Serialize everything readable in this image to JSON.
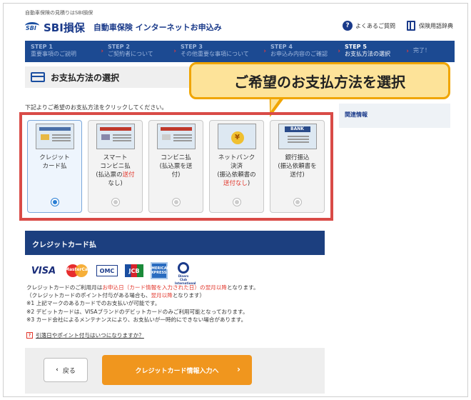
{
  "header": {
    "top_note": "自動車保険の見積りはSBI損保",
    "logo_mark": "SBI",
    "brand": "SBI損保",
    "subtitle": "自動車保険 インターネットお申込み",
    "faq_link": "よくあるご質問",
    "glossary_link": "保険用語辞典"
  },
  "steps": [
    {
      "num": "STEP 1",
      "label": "重要事項のご説明"
    },
    {
      "num": "STEP 2",
      "label": "ご契約者について"
    },
    {
      "num": "STEP 3",
      "label": "その他重要な事項について"
    },
    {
      "num": "STEP 4",
      "label": "お申込み内容のご確認"
    },
    {
      "num": "STEP 5",
      "label": "お支払方法の選択"
    },
    {
      "num": "",
      "label": "完了！"
    }
  ],
  "page_title": "お支払方法の選択",
  "callout": "ご希望のお支払方法を選択",
  "instruction": "下記よりご希望のお支払方法をクリックしてください。",
  "sidebar": {
    "related": "関連情報"
  },
  "methods": [
    {
      "line1": "クレジット",
      "line2": "カード払"
    },
    {
      "line1": "スマート",
      "line2": "コンビニ払",
      "line3": "(払込票の",
      "red": "送付",
      "line4": "なし)"
    },
    {
      "line1": "コンビニ払",
      "line2": "(払込票を送",
      "line3": "付)"
    },
    {
      "line1": "ネットバンク",
      "line2": "決済",
      "line3": "(振込依頼書の",
      "red": "送付なし",
      "line4": ")"
    },
    {
      "line1": "銀行振込",
      "line2": "(振込依頼書を",
      "line3": "送付)",
      "bank_label": "BANK"
    }
  ],
  "section": {
    "title": "クレジットカード払"
  },
  "card_brands": {
    "visa": "VISA",
    "mastercard": "MasterCard",
    "omc": "OMC",
    "jcb": "JCB",
    "amex": "AMERICAN EXPRESS",
    "diners": "Diners Club International"
  },
  "notes": {
    "n1_a": "クレジットカードのご利用月は",
    "n1_red": "お申込日（カード情報を入力された日）の翌月以降",
    "n1_b": "となります。",
    "n2_a": "（クレジットカードのポイント付与がある場合も、",
    "n2_red": "翌月以降",
    "n2_b": "となります）",
    "n3": "※1 上記マークのあるカードでのお支払いが可能です。",
    "n4": "※2 デビットカードは、VISAブランドのデビットカードのみご利用可能となっております。",
    "n5": "※3 カード会社によるメンテナンスにより、お支払いが一時的にできない場合があります。"
  },
  "faq": {
    "icon": "?",
    "text": "引落日やポイント付与はいつになりますか？"
  },
  "buttons": {
    "back": "戻る",
    "next": "クレジットカード情報入力へ"
  }
}
